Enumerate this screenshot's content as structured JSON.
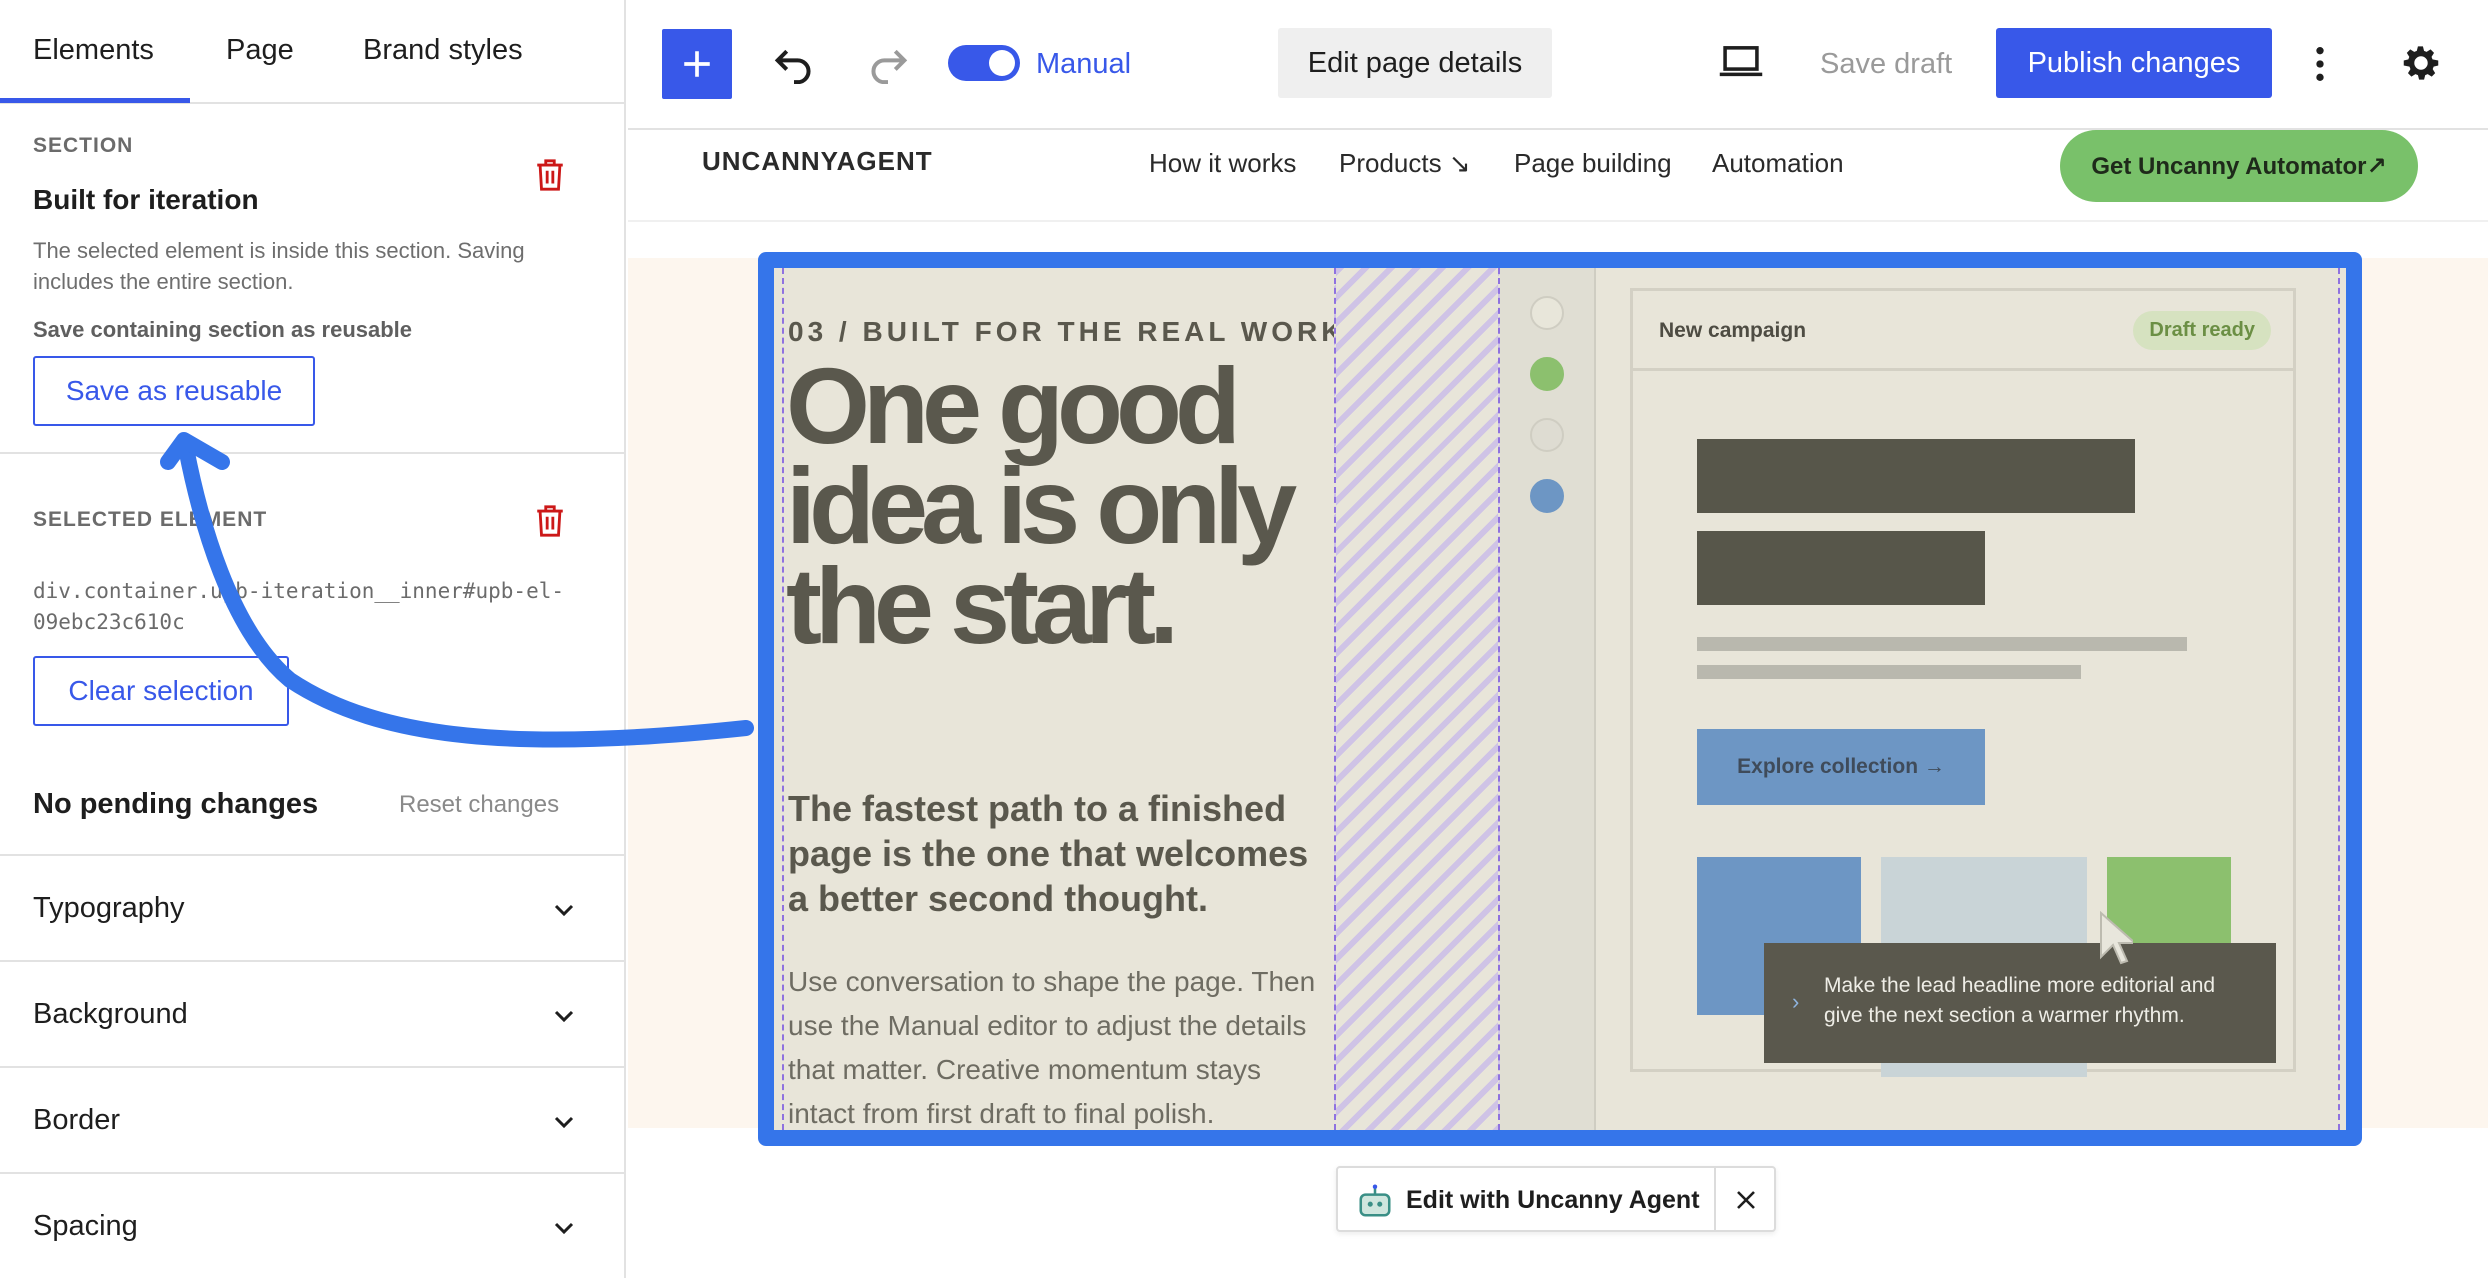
{
  "sidebar": {
    "tabs": [
      "Elements",
      "Page",
      "Brand styles"
    ],
    "section": {
      "label": "Section",
      "title": "Built for iteration",
      "description": "The selected element is inside this section. Saving includes the entire section.",
      "reusable_hint": "Save containing section as reusable",
      "save_button": "Save as reusable"
    },
    "selected": {
      "label": "Selected element",
      "selector": "div.container.upb-iteration__inner#upb-el-09ebc23c610c",
      "clear_button": "Clear selection"
    },
    "pending": {
      "status": "No pending changes",
      "reset": "Reset changes"
    },
    "accordions": [
      "Typography",
      "Background",
      "Border",
      "Spacing"
    ]
  },
  "toolbar": {
    "mode_label": "Manual",
    "edit_details": "Edit page details",
    "save_draft": "Save draft",
    "publish": "Publish changes"
  },
  "site": {
    "logo": "UNCANNYAGENT",
    "nav": [
      "How it works",
      "Products ↘",
      "Page building",
      "Automation"
    ],
    "cta": "Get Uncanny Automator↗",
    "eyebrow": "03 / BUILT FOR THE REAL WORK",
    "headline": "One good idea is only the start.",
    "subhead": "The fastest path to a finished page is the one that welcomes a better second thought.",
    "body": "Use conversation to shape the page. Then use the Manual editor to adjust the details that matter. Creative momentum stays intact from first draft to final polish.",
    "mock": {
      "title": "New campaign",
      "badge": "Draft ready",
      "explore": "Explore collection →",
      "tooltip": "Make the lead headline more editorial and give the next section a warmer rhythm."
    }
  },
  "agent_bar": {
    "label": "Edit with Uncanny Agent"
  },
  "colors": {
    "accent": "#3858e9",
    "selection": "#3575ea",
    "danger": "#cc1818",
    "cta": "#79c16a"
  }
}
